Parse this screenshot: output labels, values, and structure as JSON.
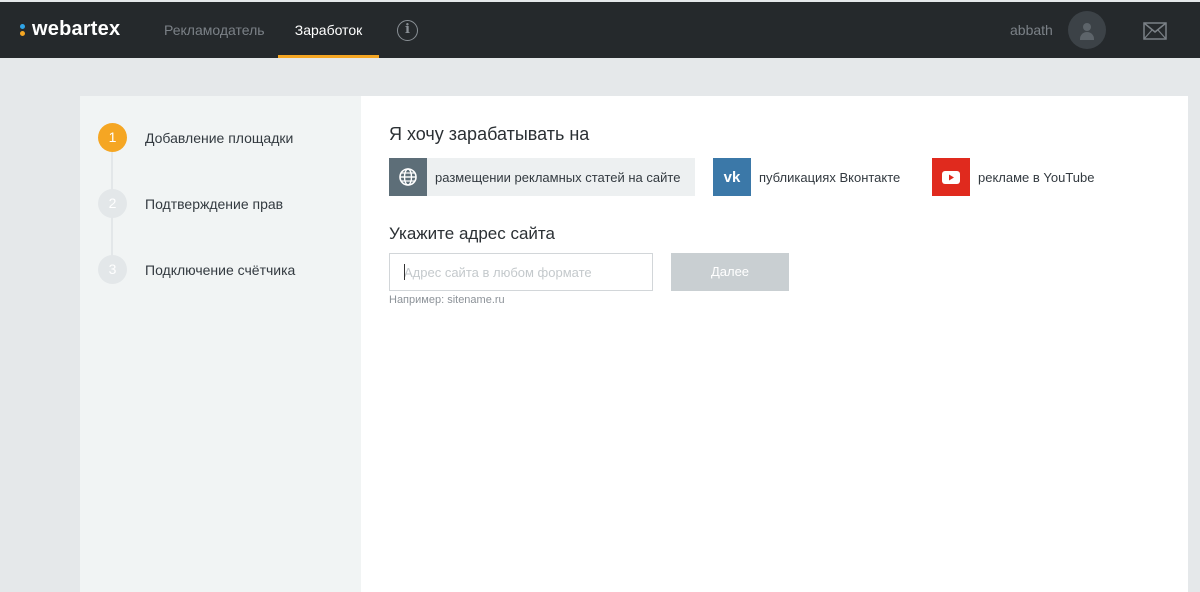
{
  "header": {
    "logo_text": "webartex",
    "nav": [
      {
        "label": "Рекламодатель",
        "active": false
      },
      {
        "label": "Заработок",
        "active": true
      }
    ],
    "info_icon": "info-circle-icon",
    "username": "abbath",
    "avatar_icon": "user-avatar-icon",
    "mail_icon": "envelope-icon"
  },
  "steps": [
    {
      "number": "1",
      "label": "Добавление площадки",
      "active": true
    },
    {
      "number": "2",
      "label": "Подтверждение прав",
      "active": false
    },
    {
      "number": "3",
      "label": "Подключение счётчика",
      "active": false
    }
  ],
  "main": {
    "heading": "Я хочу зарабатывать на",
    "options": [
      {
        "label": "размещении рекламных статей на сайте",
        "icon": "globe-icon",
        "selected": true
      },
      {
        "label": "публикациях Вконтакте",
        "icon": "vk-icon",
        "icon_text": "vk",
        "selected": false
      },
      {
        "label": "рекламе в YouTube",
        "icon": "youtube-icon",
        "selected": false
      }
    ],
    "address_heading": "Укажите адрес сайта",
    "input": {
      "value": "",
      "placeholder": "Адрес сайта в любом формате"
    },
    "next_button": "Далее",
    "hint": "Например: sitename.ru"
  },
  "colors": {
    "accent": "#f5a623",
    "topbar": "#25292c",
    "vk": "#3b78a8",
    "youtube": "#e02a1e"
  }
}
